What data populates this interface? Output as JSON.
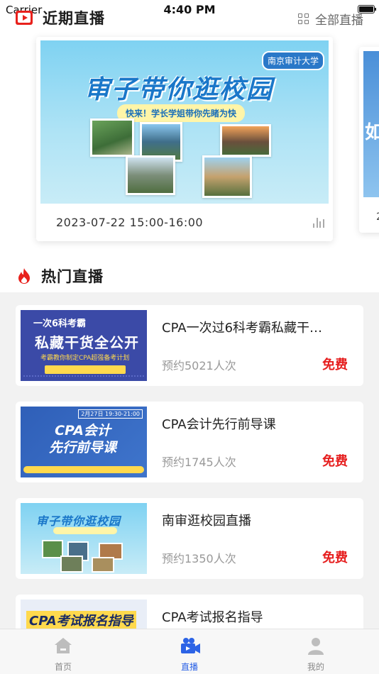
{
  "status_bar": {
    "carrier": "Carrier",
    "time": "4:40 PM"
  },
  "recent": {
    "title": "近期直播",
    "all_label": "全部直播",
    "featured": {
      "banner_title": "审子带你逛校园",
      "banner_badge": "南京审计大学",
      "banner_subtitle": "快来！学长学姐带你先睹为快",
      "time": "2023-07-22 15:00-16:00"
    },
    "peek": {
      "char": "如",
      "dot": "2"
    }
  },
  "hot": {
    "title": "热门直播",
    "items": [
      {
        "title": "CPA一次过6科考霸私藏干…",
        "count": "预约5021人次",
        "price": "免费",
        "thumb": {
          "line1": "一次6科考霸",
          "line2": "私藏干货全公开",
          "line3": "考霸教你制定CPA超强备考计划"
        }
      },
      {
        "title": "CPA会计先行前导课",
        "count": "预约1745人次",
        "price": "免费",
        "thumb": {
          "main": "CPA会计\n先行前导课",
          "date": "2月27日 19:30-21:00"
        }
      },
      {
        "title": "南审逛校园直播",
        "count": "预约1350人次",
        "price": "免费",
        "thumb": {
          "main": "审子带你逛校园"
        }
      },
      {
        "title": "CPA考试报名指导",
        "count": "",
        "price": "",
        "thumb": {
          "main": "CPA考试报名指导"
        }
      }
    ]
  },
  "tabs": [
    {
      "label": "首页",
      "icon": "home-icon",
      "active": false
    },
    {
      "label": "直播",
      "icon": "video-camera-icon",
      "active": true
    },
    {
      "label": "我的",
      "icon": "user-icon",
      "active": false
    }
  ],
  "colors": {
    "accent": "#2c63e6",
    "price": "#e61e1e",
    "live_red": "#e8211c"
  }
}
